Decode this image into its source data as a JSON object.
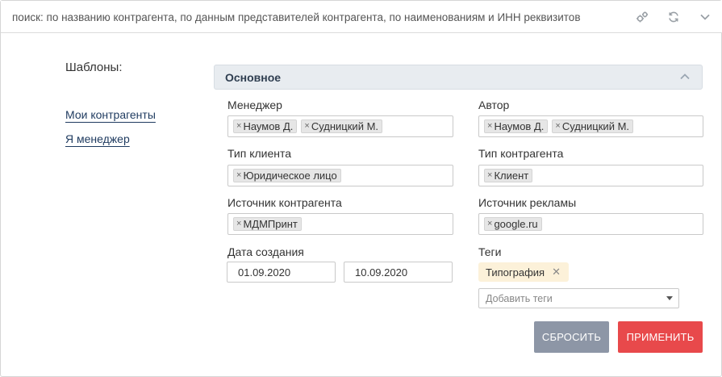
{
  "search": {
    "placeholder": "поиск: по названию контрагента, по данным представителей контрагента, по наименованиям и ИНН реквизитов",
    "icons": [
      "settings-gears-icon",
      "refresh-icon",
      "chevron-down-icon"
    ]
  },
  "templates": {
    "title": "Шаблоны:",
    "links": [
      "Мои контрагенты",
      "Я менеджер"
    ]
  },
  "panel": {
    "title": "Основное"
  },
  "fields": {
    "manager": {
      "label": "Менеджер",
      "chips": [
        "Наумов Д.",
        "Судницкий М."
      ]
    },
    "author": {
      "label": "Автор",
      "chips": [
        "Наумов Д.",
        "Судницкий М."
      ]
    },
    "client_type": {
      "label": "Тип клиента",
      "chips": [
        "Юридическое лицо"
      ]
    },
    "counterparty_type": {
      "label": "Тип контрагента",
      "chips": [
        "Клиент"
      ]
    },
    "counterparty_source": {
      "label": "Источник контрагента",
      "chips": [
        "МДМПринт"
      ]
    },
    "ad_source": {
      "label": "Источник рекламы",
      "chips": [
        "google.ru"
      ]
    },
    "created": {
      "label": "Дата создания",
      "from": "01.09.2020",
      "to": "10.09.2020"
    },
    "tags": {
      "label": "Теги",
      "items": [
        "Типография"
      ],
      "placeholder": "Добавить теги",
      "remove_glyph": "✕"
    }
  },
  "chip_remove_glyph": "×",
  "buttons": {
    "reset": "СБРОСИТЬ",
    "apply": "ПРИМЕНИТЬ"
  },
  "colors": {
    "link": "#1e3a5f",
    "panel_header_bg": "#e8ecf0",
    "tag_bg": "#fcf1d9",
    "reset_bg": "#8d96a6",
    "apply_bg": "#e8494b"
  }
}
